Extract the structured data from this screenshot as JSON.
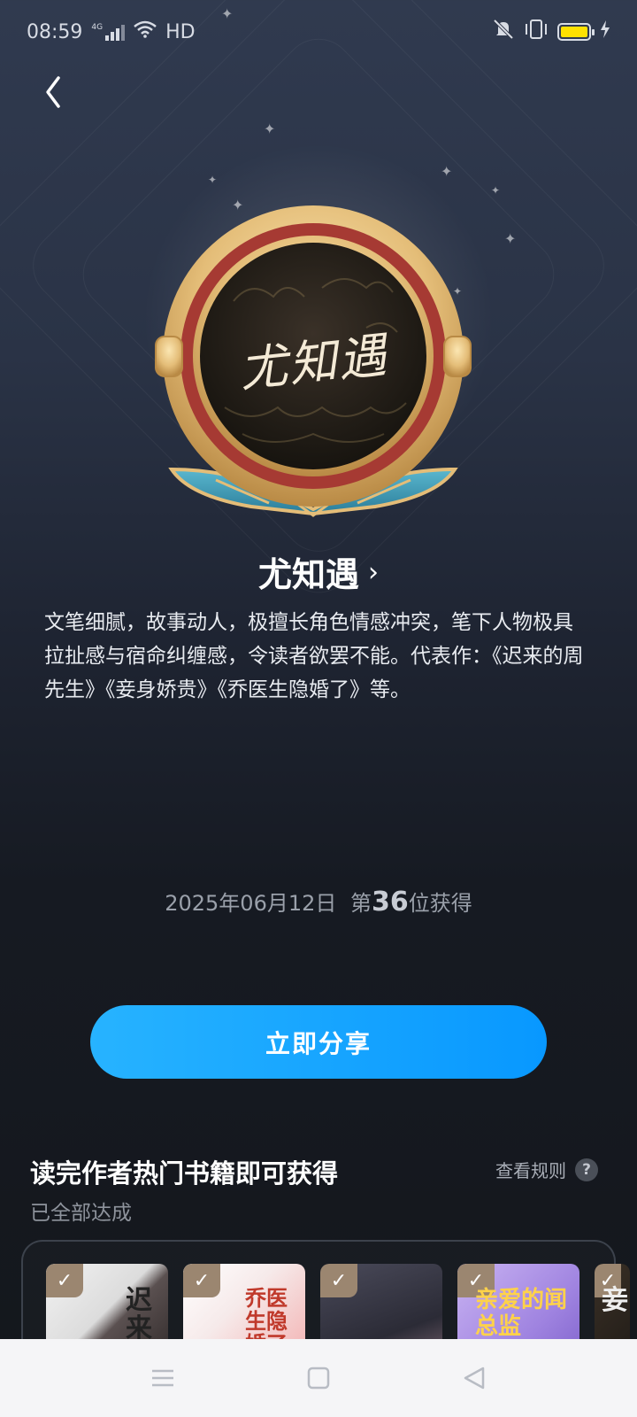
{
  "status_bar": {
    "time": "08:59",
    "network": "4G",
    "wifi_label": "HD",
    "icons": [
      "signal-icon",
      "wifi-icon",
      "mute-icon",
      "vibrate-icon",
      "battery-icon",
      "charging-icon"
    ],
    "battery_color": "#ffe100"
  },
  "badge": {
    "signature": "尤知遇",
    "colors": {
      "gold": "#e9c98a",
      "red": "#a63a33",
      "teal": "#3f9ab3",
      "dark": "#1e1b17"
    }
  },
  "author": {
    "name": "尤知遇",
    "chevron": "›",
    "description": "文笔细腻，故事动人，极擅长角色情感冲突，笔下人物极具拉扯感与宿命纠缠感，令读者欲罢不能。代表作：《迟来的周先生》《妾身娇贵》《乔医生隐婚了》等。"
  },
  "achievement": {
    "date": "2025年06月12日",
    "rank_prefix": "第",
    "rank": "36",
    "rank_suffix": "位获得"
  },
  "share_button": {
    "label": "立即分享",
    "color": "#0a9cff"
  },
  "books_section": {
    "title": "读完作者热门书籍即可获得",
    "status": "已全部达成",
    "rules_label": "查看规则",
    "rules_icon": "?",
    "books": [
      {
        "cover_text": "迟来的周先生",
        "checked": true
      },
      {
        "cover_text": "乔医生隐婚了",
        "checked": true
      },
      {
        "cover_text": "",
        "checked": true
      },
      {
        "cover_text": "亲爱的闻总监",
        "checked": true
      },
      {
        "cover_text": "妾",
        "checked": true
      }
    ],
    "check_mark": "✓"
  },
  "nav_bar": {
    "icons": [
      "menu-icon",
      "home-icon",
      "back-triangle-icon"
    ]
  }
}
